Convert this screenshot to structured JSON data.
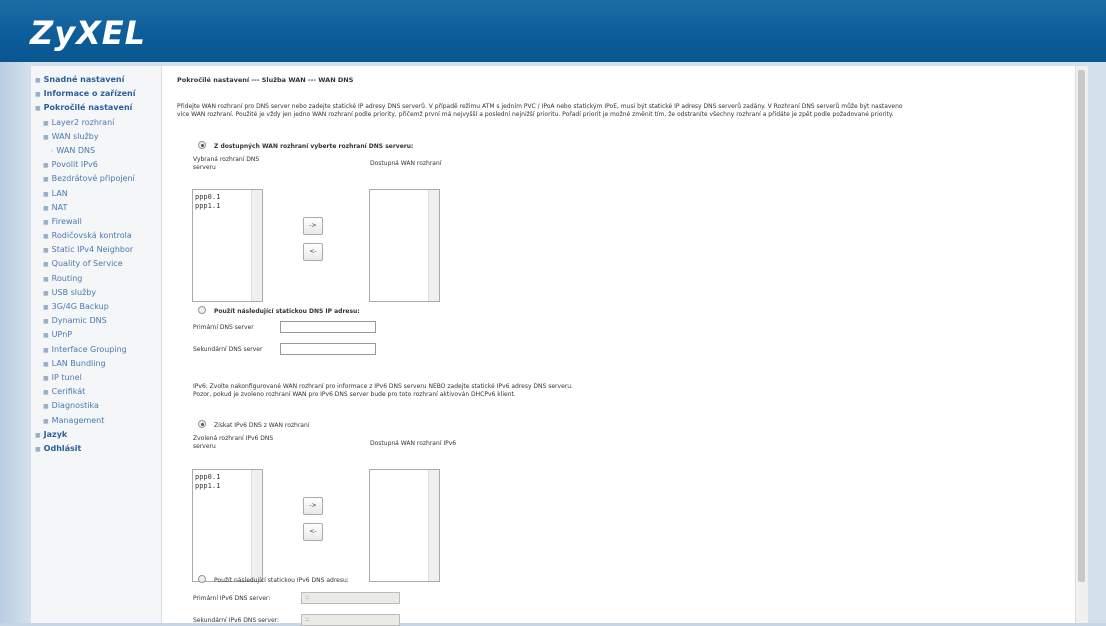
{
  "brand": {
    "logo": "ZyXEL"
  },
  "sidebar": {
    "items": [
      {
        "label": "Snadné nastavení",
        "level": "top"
      },
      {
        "label": "Informace o zařízení",
        "level": "top"
      },
      {
        "label": "Pokročilé nastavení",
        "level": "top"
      },
      {
        "label": "Layer2 rozhraní",
        "level": "sub"
      },
      {
        "label": "WAN služby",
        "level": "sub"
      },
      {
        "label": "WAN DNS",
        "level": "subsub"
      },
      {
        "label": "Povolit IPv6",
        "level": "sub"
      },
      {
        "label": "Bezdrátové připojení",
        "level": "sub"
      },
      {
        "label": "LAN",
        "level": "sub"
      },
      {
        "label": "NAT",
        "level": "sub"
      },
      {
        "label": "Firewall",
        "level": "sub"
      },
      {
        "label": "Rodičovská kontrola",
        "level": "sub"
      },
      {
        "label": "Static IPv4 Neighbor",
        "level": "sub"
      },
      {
        "label": "Quality of Service",
        "level": "sub"
      },
      {
        "label": "Routing",
        "level": "sub"
      },
      {
        "label": "USB služby",
        "level": "sub"
      },
      {
        "label": "3G/4G Backup",
        "level": "sub"
      },
      {
        "label": "Dynamic DNS",
        "level": "sub"
      },
      {
        "label": "UPnP",
        "level": "sub"
      },
      {
        "label": "Interface Grouping",
        "level": "sub"
      },
      {
        "label": "LAN Bundling",
        "level": "sub"
      },
      {
        "label": "IP tunel",
        "level": "sub"
      },
      {
        "label": "Cerifikát",
        "level": "sub"
      },
      {
        "label": "Diagnostika",
        "level": "sub"
      },
      {
        "label": "Management",
        "level": "sub"
      },
      {
        "label": "Jazyk",
        "level": "top"
      },
      {
        "label": "Odhlásit",
        "level": "top"
      }
    ]
  },
  "main": {
    "title": "Pokročilé nastavení --- Služba WAN --- WAN DNS",
    "intro_line1": "Přidejte WAN rozhraní pro DNS server nebo zadejte statické IP adresy DNS serverů. V případě režimu ATM s jedním PVC / IPoA nebo statickým IPoE, musí být statické IP adresy DNS serverů zadány. V Rozhraní DNS serverů může být nastaveno",
    "intro_line2": "více WAN rozhraní. Použité je vždy jen jedno WAN rozhraní podle priority, přičemž první má nejvyšší a poslední nejnižší prioritu. Pořadí priorit je možné změnit tím, že odstraníte všechny rozhraní a přidáte je zpět podle požadované priority.",
    "ipv4": {
      "radio_available_label": "Z dostupných WAN rozhraní vyberte rozhraní DNS serveru:",
      "selected_label_1": "Vybraná rozhraní DNS",
      "selected_label_2": "serveru",
      "available_label": "Dostupná WAN rozhraní",
      "selected_items": [
        "ppp0.1",
        "ppp1.1"
      ],
      "btn_right": "->",
      "btn_left": "<-",
      "radio_static_label": "Použít následující statickou DNS IP adresu:",
      "primary_label": "Primární DNS server",
      "secondary_label": "Sekundární DNS server",
      "primary_value": "",
      "secondary_value": ""
    },
    "ipv6_note1": "IPv6: Zvolte nakonfigurované WAN rozhraní pro informace z IPv6 DNS serveru NEBO zadejte statické IPv6 adresy DNS serveru.",
    "ipv6_note2": "Pozor, pokud je zvoleno rozhraní WAN pro IPv6 DNS server bude pro toto rozhraní aktivován DHCPv6 klient.",
    "ipv6": {
      "radio_obtain_label": "Získat IPv6 DNS z WAN rozhraní",
      "selected_label_1": "Zvolená rozhraní IPv6 DNS",
      "selected_label_2": "serveru",
      "available_label": "Dostupná WAN rozhraní IPv6",
      "selected_items": [
        "ppp0.1",
        "ppp1.1"
      ],
      "btn_right": "->",
      "btn_left": "<-",
      "radio_static_label": "Použít následující statickou IPv6 DNS adresu:",
      "primary_label": "Primární IPv6 DNS server:",
      "secondary_label": "Sekundární IPv6 DNS server:",
      "primary_value": "::",
      "secondary_value": "::"
    }
  }
}
